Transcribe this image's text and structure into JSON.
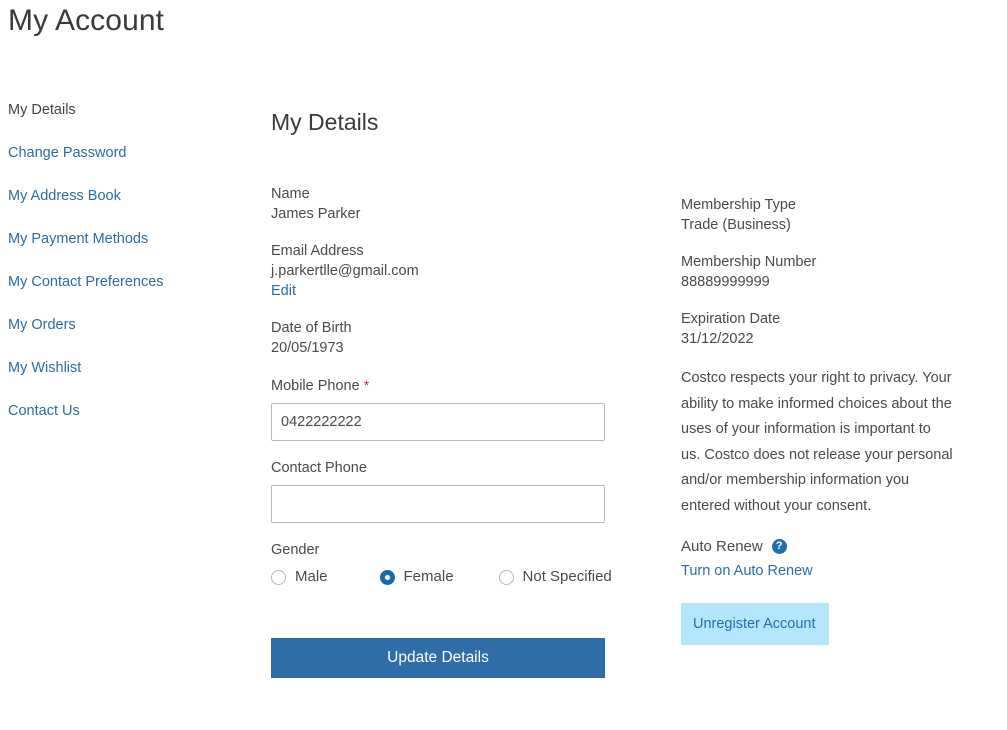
{
  "page": {
    "title": "My Account"
  },
  "sidebar": {
    "items": [
      {
        "label": "My Details",
        "current": true
      },
      {
        "label": "Change Password",
        "current": false
      },
      {
        "label": "My Address Book",
        "current": false
      },
      {
        "label": "My Payment Methods",
        "current": false
      },
      {
        "label": "My Contact Preferences",
        "current": false
      },
      {
        "label": "My Orders",
        "current": false
      },
      {
        "label": "My Wishlist",
        "current": false
      },
      {
        "label": "Contact Us",
        "current": false
      }
    ]
  },
  "details": {
    "heading": "My Details",
    "name_label": "Name",
    "name_value": "James Parker",
    "email_label": "Email Address",
    "email_value": "j.parkertlle@gmail.com",
    "email_edit_label": "Edit",
    "dob_label": "Date of Birth",
    "dob_value": "20/05/1973",
    "mobile_label": "Mobile Phone",
    "mobile_required_mark": "*",
    "mobile_value": "0422222222",
    "mobile_placeholder": "",
    "contact_phone_label": "Contact Phone",
    "contact_phone_value": "",
    "contact_phone_placeholder": "",
    "gender_label": "Gender",
    "gender_options": [
      {
        "label": "Male",
        "selected": false
      },
      {
        "label": "Female",
        "selected": true
      },
      {
        "label": "Not Specified",
        "selected": false
      }
    ],
    "submit_label": "Update Details"
  },
  "membership": {
    "type_label": "Membership Type",
    "type_value": "Trade (Business)",
    "number_label": "Membership Number",
    "number_value": "88889999999",
    "expiration_label": "Expiration Date",
    "expiration_value": "31/12/2022",
    "privacy_text": "Costco respects your right to privacy. Your ability to make informed choices about the uses of your information is important to us. Costco does not release your personal and/or membership information you entered without your consent.",
    "auto_renew_label": "Auto Renew",
    "help_icon_glyph": "?",
    "auto_renew_link": "Turn on Auto Renew",
    "unregister_label": "Unregister Account"
  },
  "colors": {
    "link": "#2b6ca8",
    "button": "#2e6da8",
    "highlight": "#b3e5fc",
    "required": "#c9302c",
    "radio_selected": "#1769a8"
  }
}
